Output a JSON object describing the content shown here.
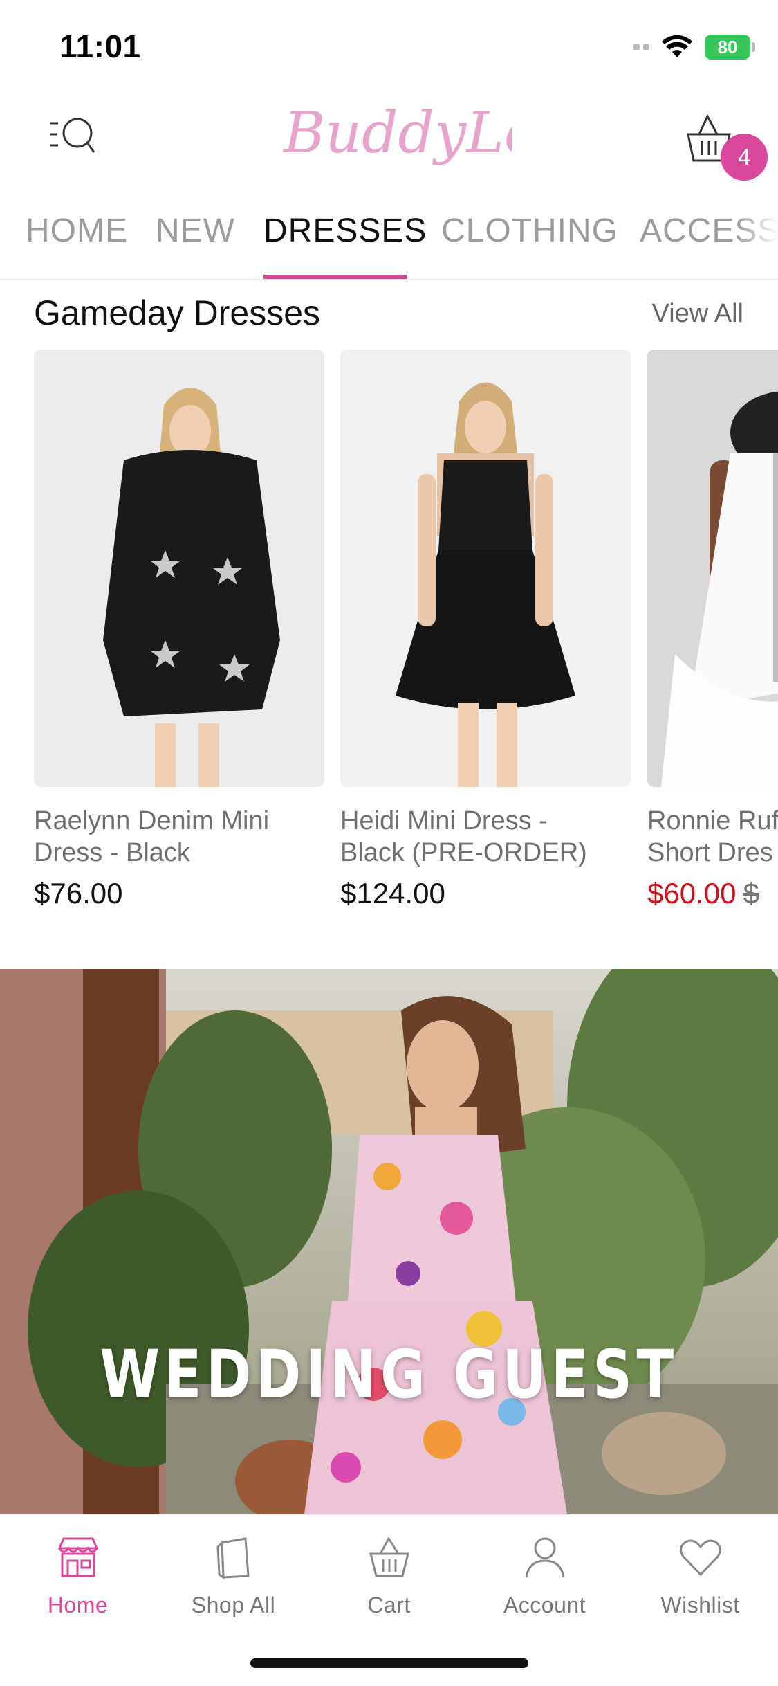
{
  "status_bar": {
    "time": "11:01",
    "battery": "80"
  },
  "header": {
    "brand": "BuddyLove",
    "cart_count": "4"
  },
  "tabs": [
    {
      "label": "HOME"
    },
    {
      "label": "NEW"
    },
    {
      "label": "DRESSES"
    },
    {
      "label": "CLOTHING"
    },
    {
      "label": "ACCESS"
    }
  ],
  "active_tab": "DRESSES",
  "section": {
    "title": "Gameday Dresses",
    "view_all": "View All"
  },
  "products": [
    {
      "name_line1": "Raelynn Denim Mini",
      "name_line2": "Dress - Black",
      "price": "$76.00"
    },
    {
      "name_line1": "Heidi Mini Dress -",
      "name_line2": "Black (PRE-ORDER)",
      "price": "$124.00"
    },
    {
      "name_line1": "Ronnie Ruf",
      "name_line2": "Short Dres",
      "sale_price": "$60.00",
      "old_price": "$"
    }
  ],
  "banner": {
    "text": "WEDDING GUEST"
  },
  "bottom_nav": [
    {
      "label": "Home",
      "icon": "storefront-icon"
    },
    {
      "label": "Shop All",
      "icon": "shopping-bag-icon"
    },
    {
      "label": "Cart",
      "icon": "basket-icon"
    },
    {
      "label": "Account",
      "icon": "person-icon"
    },
    {
      "label": "Wishlist",
      "icon": "heart-icon"
    }
  ],
  "colors": {
    "accent": "#d9489c",
    "sale": "#d10f17",
    "battery": "#34c759"
  }
}
